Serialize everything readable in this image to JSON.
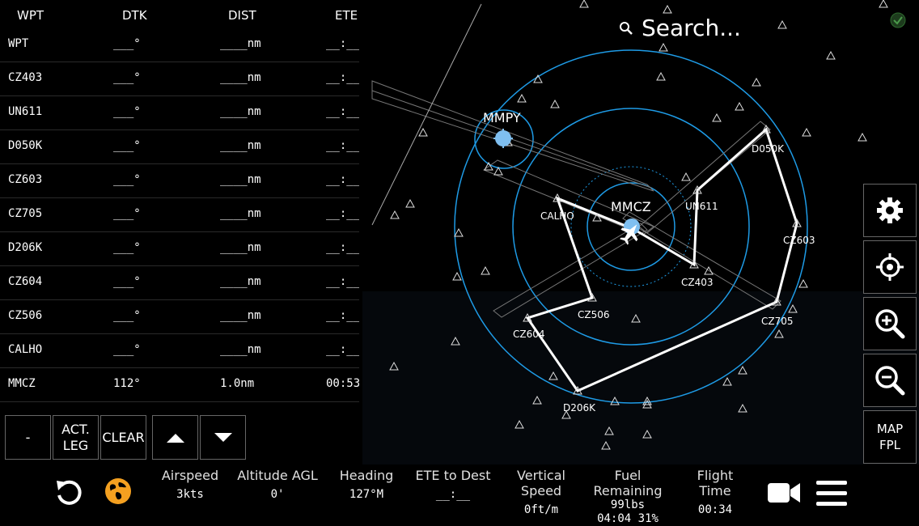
{
  "flight_plan": {
    "headers": {
      "wpt": "WPT",
      "dtk": "DTK",
      "dist": "DIST",
      "ete": "ETE"
    },
    "rows": [
      {
        "wpt": "WPT",
        "dtk": "___°",
        "dist": "____nm",
        "ete": "__:__"
      },
      {
        "wpt": "CZ403",
        "dtk": "___°",
        "dist": "____nm",
        "ete": "__:__"
      },
      {
        "wpt": "UN611",
        "dtk": "___°",
        "dist": "____nm",
        "ete": "__:__"
      },
      {
        "wpt": "D050K",
        "dtk": "___°",
        "dist": "____nm",
        "ete": "__:__"
      },
      {
        "wpt": "CZ603",
        "dtk": "___°",
        "dist": "____nm",
        "ete": "__:__"
      },
      {
        "wpt": "CZ705",
        "dtk": "___°",
        "dist": "____nm",
        "ete": "__:__"
      },
      {
        "wpt": "D206K",
        "dtk": "___°",
        "dist": "____nm",
        "ete": "__:__"
      },
      {
        "wpt": "CZ604",
        "dtk": "___°",
        "dist": "____nm",
        "ete": "__:__"
      },
      {
        "wpt": "CZ506",
        "dtk": "___°",
        "dist": "____nm",
        "ete": "__:__"
      },
      {
        "wpt": "CALHO",
        "dtk": "___°",
        "dist": "____nm",
        "ete": "__:__"
      },
      {
        "wpt": "MMCZ",
        "dtk": "112°",
        "dist": "1.0nm",
        "ete": "00:53"
      }
    ]
  },
  "buttons": {
    "minus": "-",
    "act_leg_line1": "ACT.",
    "act_leg_line2": "LEG",
    "clear": "CLEAR",
    "map_fpl_line1": "MAP",
    "map_fpl_line2": "FPL"
  },
  "search": {
    "placeholder": "Search..."
  },
  "map_labels": {
    "airport_main": "MMCZ",
    "airport_other": "MMPY",
    "waypoints": [
      "CALHO",
      "UN611",
      "D050K",
      "CZ603",
      "CZ403",
      "CZ705",
      "CZ506",
      "CZ604",
      "D206K"
    ]
  },
  "status": {
    "airspeed": {
      "label": "Airspeed",
      "value": "3kts"
    },
    "altitude": {
      "label": "Altitude AGL",
      "value": "0'"
    },
    "heading": {
      "label": "Heading",
      "value": "127°M"
    },
    "ete": {
      "label": "ETE to Dest",
      "value": "__:__"
    },
    "vspeed": {
      "label": "Vertical Speed",
      "value": "0ft/m"
    },
    "fuel": {
      "label": "Fuel Remaining",
      "value1": "99lbs",
      "value2": "04:04 31%"
    },
    "flighttime": {
      "label": "Flight Time",
      "value": "00:34"
    }
  },
  "icons": {
    "refresh": "refresh-icon",
    "globe": "globe-icon",
    "settings": "gear-icon",
    "center": "crosshair-icon",
    "zoom_in": "zoom-in-icon",
    "zoom_out": "zoom-out-icon",
    "camera": "video-camera-icon",
    "menu": "hamburger-menu-icon"
  },
  "colors": {
    "range_ring": "#1e9be6",
    "route": "#ffffff",
    "accent": "#f4a020",
    "airport": "#7fbff0"
  }
}
